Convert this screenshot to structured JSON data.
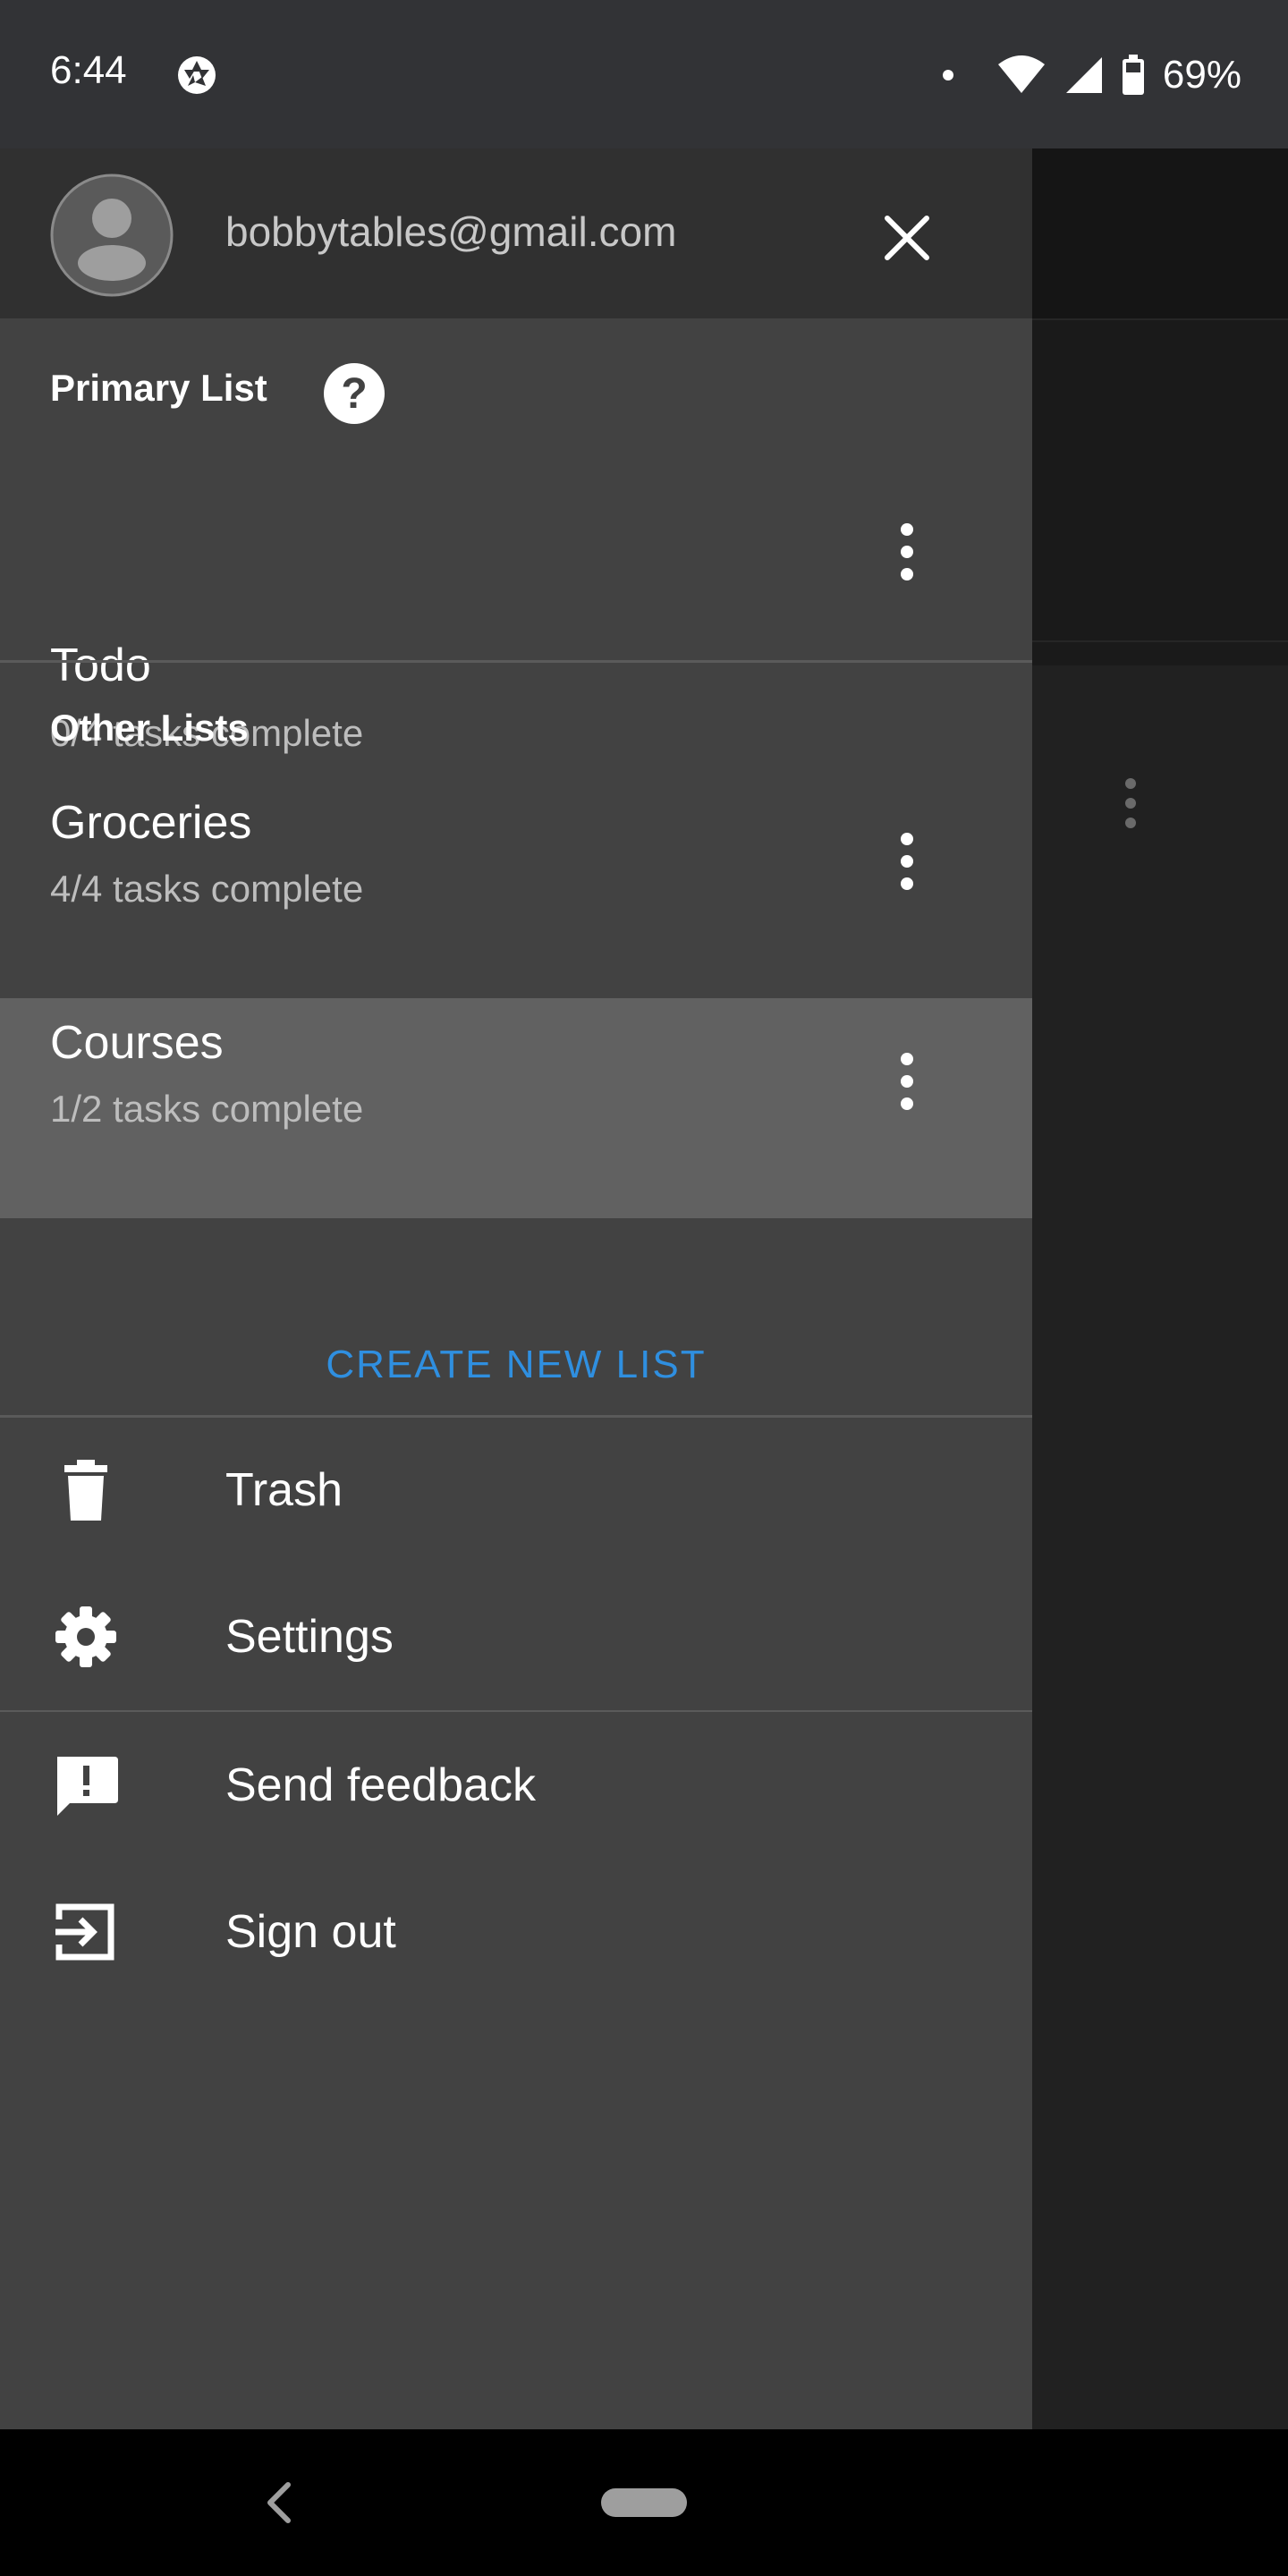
{
  "status_bar": {
    "time": "6:44",
    "battery": "69%"
  },
  "account": {
    "email": "bobbytables@gmail.com"
  },
  "primary_section": {
    "title": "Primary List",
    "items": [
      {
        "name": "Todo",
        "progress": "0/4 tasks complete"
      }
    ]
  },
  "other_section": {
    "title": "Other Lists",
    "items": [
      {
        "name": "Groceries",
        "progress": "4/4 tasks complete"
      },
      {
        "name": "Courses",
        "progress": "1/2 tasks complete"
      }
    ]
  },
  "create_list_label": "CREATE NEW LIST",
  "menu": [
    {
      "label": "Trash",
      "icon": "trash-icon"
    },
    {
      "label": "Settings",
      "icon": "gear-icon"
    },
    {
      "label": "Send feedback",
      "icon": "feedback-icon"
    },
    {
      "label": "Sign out",
      "icon": "sign-out-icon"
    }
  ],
  "colors": {
    "accent": "#2f8fe0",
    "drawer": "#424242",
    "selected": "#616161"
  }
}
